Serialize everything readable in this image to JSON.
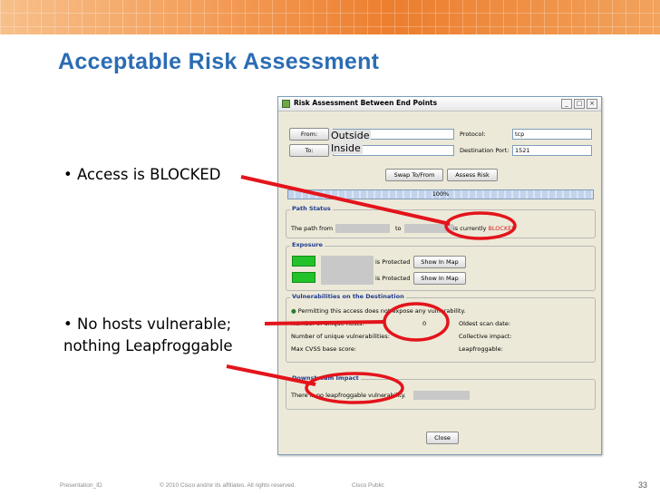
{
  "slide": {
    "title": "Acceptable Risk Assessment",
    "bullets": [
      "• Access is BLOCKED",
      "• No hosts vulnerable;",
      "nothing Leapfroggable"
    ]
  },
  "dialog": {
    "title": "Risk Assessment Between End Points",
    "controls": {
      "minimize": "_",
      "maximize": "□",
      "close": "×"
    },
    "from_button": "From:",
    "to_button": "To:",
    "from_value": "Outside",
    "to_value": "Inside",
    "protocol_label": "Protocol:",
    "protocol_value": "tcp",
    "dest_port_label": "Destination Port:",
    "dest_port_value": "1521",
    "swap_button": "Swap To/From",
    "assess_button": "Assess Risk",
    "progress_text": "100%",
    "progress_value": 1.0,
    "path_status": {
      "title": "Path Status",
      "the_path_from": "The path from",
      "to": "to",
      "currently": "is currently",
      "blocked": "BLOCKED"
    },
    "exposure": {
      "title": "Exposure",
      "rows": [
        {
          "status": "is Protected",
          "button": "Show In Map"
        },
        {
          "status": "is Protected",
          "button": "Show In Map"
        }
      ]
    },
    "vulnerabilities": {
      "title": "Vulnerabilities on the Destination",
      "permit_text": "Permitting this access does not expose any vulnerability.",
      "unique_hosts_label": "Number of unique hosts:",
      "unique_hosts_value": "0",
      "oldest_scan_label": "Oldest scan date:",
      "unique_vulns_label": "Number of unique vulnerabilities:",
      "collective_label": "Collective impact:",
      "max_cvss_label": "Max CVSS base score:",
      "leapfroggable_label": "Leapfroggable:"
    },
    "downstream": {
      "title": "Downstream Impact",
      "text": "There is no leapfroggable vulnerability."
    },
    "close_button": "Close"
  },
  "footer": {
    "presentation_id": "Presentation_ID",
    "copyright": "© 2010 Cisco and/or its affiliates. All rights reserved.",
    "classification": "Cisco Public",
    "page": "33"
  },
  "colors": {
    "title": "#2b6cb3",
    "annotation": "#e3141b",
    "stripe": "#ec7e2e"
  }
}
